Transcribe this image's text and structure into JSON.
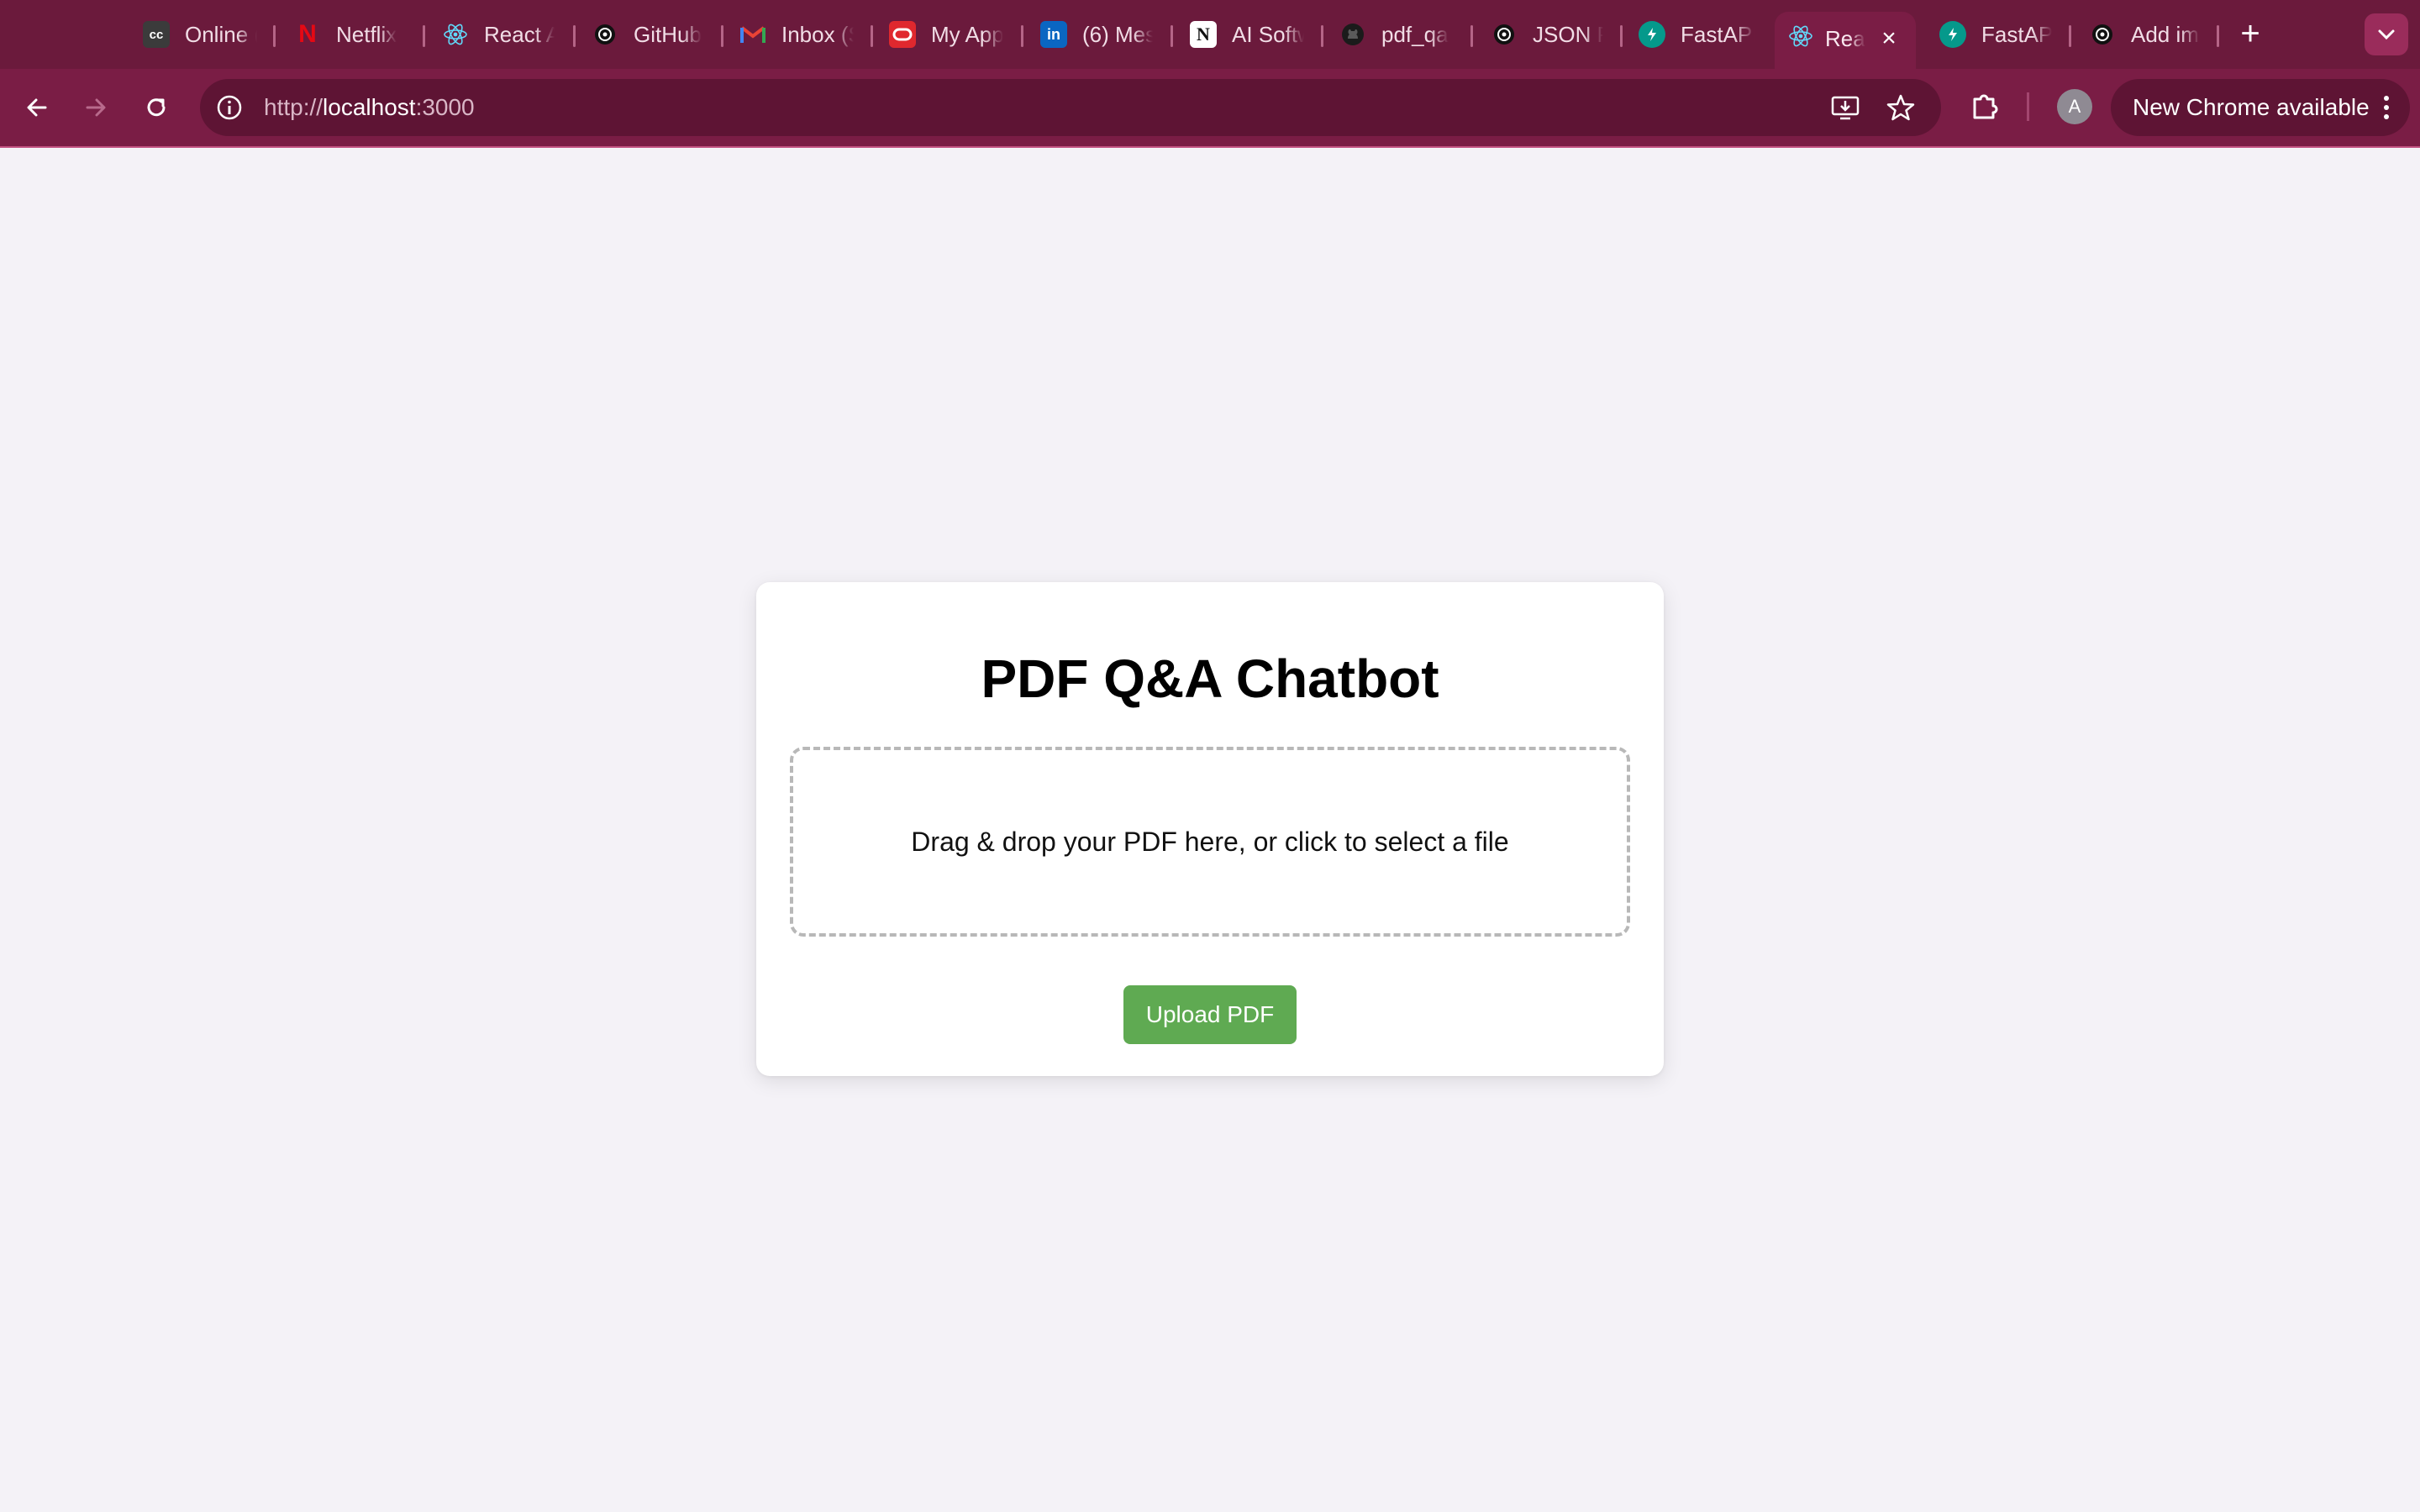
{
  "browser": {
    "tabs": [
      {
        "label": "Online (",
        "icon": "cc-icon"
      },
      {
        "label": "Netflix",
        "icon": "netflix-icon"
      },
      {
        "label": "React A",
        "icon": "react-icon"
      },
      {
        "label": "GitHub",
        "icon": "openai-icon"
      },
      {
        "label": "Inbox (S",
        "icon": "gmail-icon"
      },
      {
        "label": "My App",
        "icon": "oracle-icon"
      },
      {
        "label": "(6) Mes",
        "icon": "linkedin-icon"
      },
      {
        "label": "AI Softw",
        "icon": "notion-icon"
      },
      {
        "label": "pdf_qa",
        "icon": "github-icon"
      },
      {
        "label": "JSON P",
        "icon": "openai-icon"
      },
      {
        "label": "FastAPI",
        "icon": "fastapi-icon"
      },
      {
        "label": "Rea",
        "icon": "react-icon",
        "active": true
      },
      {
        "label": "FastAPI",
        "icon": "fastapi-icon"
      },
      {
        "label": "Add ima",
        "icon": "openai-icon"
      }
    ],
    "url": {
      "scheme": "http://",
      "host": "localhost",
      "port": ":3000"
    },
    "profile_initial": "A",
    "new_chrome_label": "New Chrome available",
    "colors": {
      "frame": "#7a1d45",
      "tabstrip": "#6b1a3c",
      "omnibox": "#5e1434"
    }
  },
  "page": {
    "title": "PDF Q&A Chatbot",
    "dropzone_text": "Drag & drop your PDF here, or click to select a file",
    "upload_button": "Upload PDF",
    "colors": {
      "background": "#f4f2f7",
      "card": "#ffffff",
      "button": "#5faa52"
    }
  }
}
